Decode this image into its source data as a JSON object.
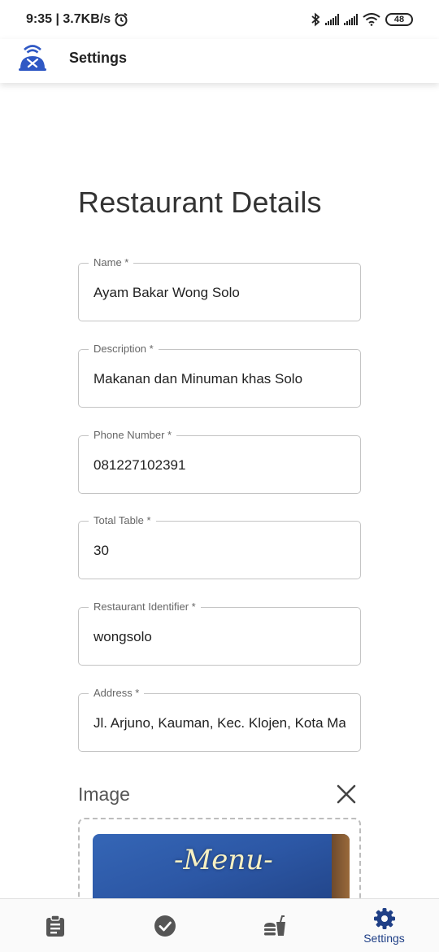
{
  "status_bar": {
    "time_and_speed": "9:35 | 3.7KB/s",
    "battery": "48"
  },
  "app_bar": {
    "title": "Settings"
  },
  "form": {
    "heading": "Restaurant Details",
    "fields": [
      {
        "label": "Name *",
        "value": "Ayam Bakar Wong Solo"
      },
      {
        "label": "Description *",
        "value": "Makanan dan Minuman khas Solo"
      },
      {
        "label": "Phone Number *",
        "value": "081227102391"
      },
      {
        "label": "Total Table *",
        "value": "30"
      },
      {
        "label": "Restaurant Identifier *",
        "value": "wongsolo"
      },
      {
        "label": "Address *",
        "value": "Jl. Arjuno, Kauman, Kec. Klojen, Kota Malang"
      }
    ],
    "image_section": {
      "heading": "Image",
      "preview_text": "-Menu-"
    }
  },
  "bottom_nav": {
    "items": [
      {
        "icon": "clipboard-icon",
        "label": ""
      },
      {
        "icon": "check-circle-icon",
        "label": ""
      },
      {
        "icon": "fastfood-icon",
        "label": ""
      },
      {
        "icon": "gear-icon",
        "label": "Settings",
        "active": true
      }
    ]
  },
  "colors": {
    "accent": "#1f3f86",
    "field_border": "#c4c4c4",
    "icon_gray": "#555555"
  }
}
